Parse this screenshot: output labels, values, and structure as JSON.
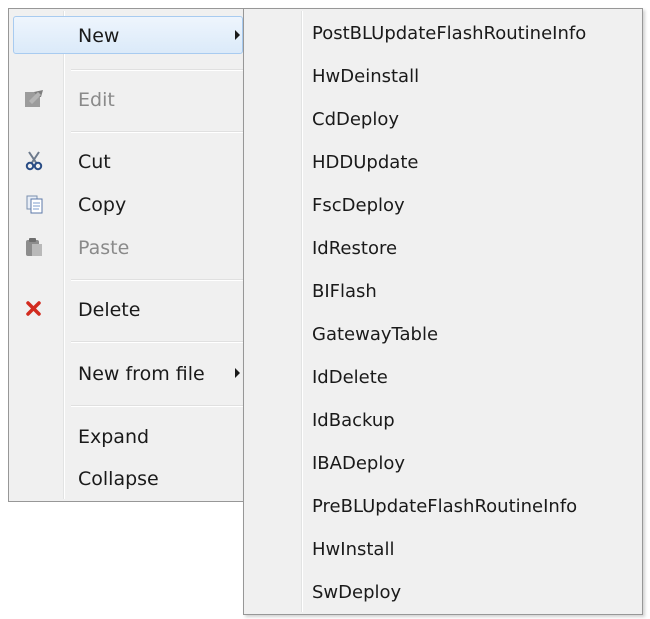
{
  "context_menu": {
    "items": [
      {
        "label": "New",
        "has_submenu": true,
        "highlighted": true,
        "enabled": true,
        "icon": null
      },
      {
        "label": "Edit",
        "enabled": false,
        "icon": "edit-icon"
      },
      {
        "label": "Cut",
        "enabled": true,
        "icon": "cut-icon"
      },
      {
        "label": "Copy",
        "enabled": true,
        "icon": "copy-icon"
      },
      {
        "label": "Paste",
        "enabled": false,
        "icon": "paste-icon"
      },
      {
        "label": "Delete",
        "enabled": true,
        "icon": "delete-icon"
      },
      {
        "label": "New from file",
        "has_submenu": true,
        "enabled": true,
        "icon": null
      },
      {
        "label": "Expand",
        "enabled": true,
        "icon": null
      },
      {
        "label": "Collapse",
        "enabled": true,
        "icon": null
      }
    ]
  },
  "submenu": {
    "items": [
      {
        "label": "PostBLUpdateFlashRoutineInfo"
      },
      {
        "label": "HwDeinstall"
      },
      {
        "label": "CdDeploy"
      },
      {
        "label": "HDDUpdate"
      },
      {
        "label": "FscDeploy"
      },
      {
        "label": "IdRestore"
      },
      {
        "label": "BIFlash"
      },
      {
        "label": "GatewayTable"
      },
      {
        "label": "IdDelete"
      },
      {
        "label": "IdBackup"
      },
      {
        "label": "IBADeploy"
      },
      {
        "label": "PreBLUpdateFlashRoutineInfo"
      },
      {
        "label": "HwInstall"
      },
      {
        "label": "SwDeploy"
      }
    ]
  },
  "colors": {
    "menu_bg": "#f0f0f0",
    "border": "#979797",
    "highlight_border": "#a8cbf0",
    "disabled_text": "#8a8a8a",
    "delete_icon": "#d22b1f"
  }
}
